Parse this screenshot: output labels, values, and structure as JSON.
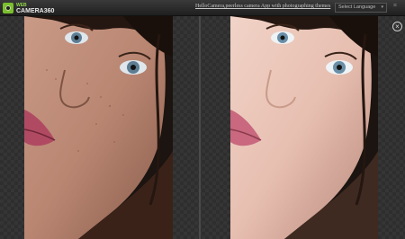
{
  "header": {
    "logo_line1": "WEB",
    "logo_line2": "CAMERA360",
    "tagline": "HelloCamera,peerless camera App with photographing themes",
    "language_select": "Select Language"
  },
  "colors": {
    "brand": "#7bbf2e",
    "background": "#262626"
  },
  "icons": {
    "close": "close-circle-icon",
    "dropdown": "chevron-down-icon"
  }
}
